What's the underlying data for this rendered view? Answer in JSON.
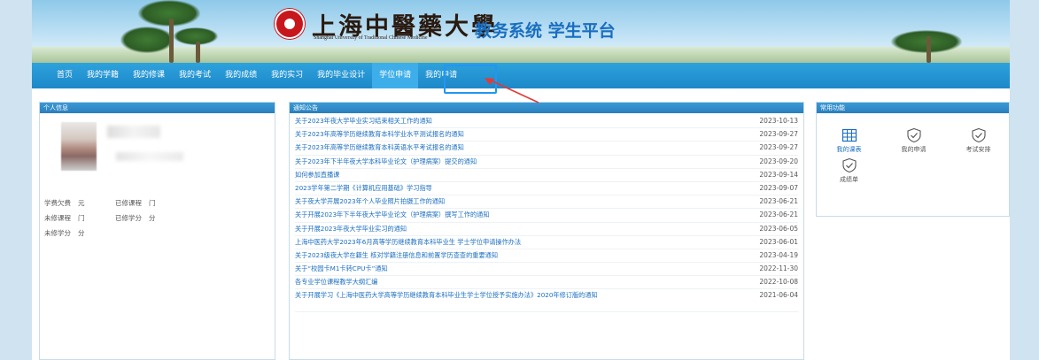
{
  "header": {
    "school_cn": "上海中醫藥大學",
    "school_en": "Shanghai University of Traditional Chinese Medicine",
    "system_title": "教务系统 学生平台"
  },
  "nav": [
    {
      "label": "首页"
    },
    {
      "label": "我的学籍"
    },
    {
      "label": "我的修课"
    },
    {
      "label": "我的考试"
    },
    {
      "label": "我的成绩"
    },
    {
      "label": "我的实习"
    },
    {
      "label": "我的毕业设计"
    },
    {
      "label": "学位申请",
      "active": true
    },
    {
      "label": "我的申请"
    }
  ],
  "personal": {
    "title": "个人信息",
    "stats": [
      {
        "label": "学费欠费",
        "value": "元"
      },
      {
        "label": "已修课程",
        "value": "门"
      },
      {
        "label": "未修课程",
        "value": "门"
      },
      {
        "label": "已修学分",
        "value": "分"
      },
      {
        "label": "未修学分",
        "value": "分"
      }
    ]
  },
  "notices": {
    "title": "通知公告",
    "items": [
      {
        "title": "关于2023年夜大学毕业实习结束相关工作的通知",
        "date": "2023-10-13"
      },
      {
        "title": "关于2023年高等学历继续教育本科学业水平测试报名的通知",
        "date": "2023-09-27"
      },
      {
        "title": "关于2023年高等学历继续教育本科英语水平考试报名的通知",
        "date": "2023-09-27"
      },
      {
        "title": "关于2023年下半年夜大学本科毕业论文（护理病案）提交的通知",
        "date": "2023-09-20"
      },
      {
        "title": "如何参加直播课",
        "date": "2023-09-14"
      },
      {
        "title": "2023学年第二学期《计算机应用基础》学习指导",
        "date": "2023-09-07"
      },
      {
        "title": "关于夜大学开展2023年个人毕业照片拍摄工作的通知",
        "date": "2023-06-21"
      },
      {
        "title": "关于开展2023年下半年夜大学毕业论文（护理病案）撰写工作的通知",
        "date": "2023-06-21"
      },
      {
        "title": "关于开展2023年夜大学毕业实习的通知",
        "date": "2023-06-05"
      },
      {
        "title": "上海中医药大学2023年6月高等学历继续教育本科毕业生 学士学位申请操作办法",
        "date": "2023-06-01"
      },
      {
        "title": "关于2023级夜大学在籍生 核对学籍注册信息和前置学历查查的重要通知",
        "date": "2023-04-19"
      },
      {
        "title": "关于“校园卡M1卡转CPU卡”通知",
        "date": "2022-11-30"
      },
      {
        "title": "各专业学位课程教学大纲汇编",
        "date": "2022-10-08"
      },
      {
        "title": "关于开展学习《上海中医药大学高等学历继续教育本科毕业生学士学位授予实施办法》2020年修订版的通知",
        "date": "2021-06-04"
      }
    ]
  },
  "functions": {
    "title": "常用功能",
    "items": [
      {
        "label": "我的课表",
        "icon": "calendar-grid-icon"
      },
      {
        "label": "我的申请",
        "icon": "shield-check-icon"
      },
      {
        "label": "考试安排",
        "icon": "shield-check-icon"
      },
      {
        "label": "成绩单",
        "icon": "shield-check-icon"
      }
    ]
  },
  "colors": {
    "nav": "#1e88c8",
    "link": "#1a6ec0",
    "logo": "#c8161d",
    "annotation": "#e53935"
  }
}
